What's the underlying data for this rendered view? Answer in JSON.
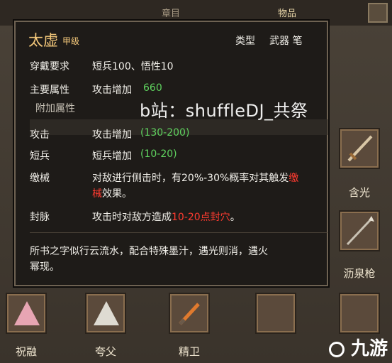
{
  "top_tabs": {
    "left": "章目",
    "right": "物品"
  },
  "tooltip": {
    "name": "太虚",
    "grade": "甲级",
    "type_label": "类型",
    "type_value": "武器 笔",
    "req_label": "穿戴要求",
    "req_value": "短兵100、悟性10",
    "main_label": "主要属性",
    "main_text": "攻击增加",
    "main_value": "660",
    "extra_header": "附加属性",
    "attack_label": "攻击",
    "attack_text": "攻击增加",
    "attack_value": "(130-200)",
    "short_label": "短兵",
    "short_text": "短兵增加",
    "short_value": "(10-20)",
    "disarm_label": "缴械",
    "disarm_text_1": "对敌进行侧击时，有20%-30%概率对其触发",
    "disarm_red_1": "缴",
    "disarm_red_2": "械",
    "disarm_text_2": "效果。",
    "seal_label": "封脉",
    "seal_text": "攻击时对敌方造成",
    "seal_red": "10-20点封穴",
    "seal_end": "。",
    "desc_1": "所书之字似行云流水，配合特殊墨汁，遇光则消，遇火",
    "desc_2": "幂现。"
  },
  "watermark": "b站：shuffleDJ_共祭",
  "logo": "九游",
  "items": {
    "hanguang": "含光",
    "liquanqiang": "沥泉枪",
    "zhurong": "祝融",
    "kuafu": "夸父",
    "jingwei": "精卫"
  },
  "colors": {
    "accent": "#f3c77a",
    "green": "#5fd35f",
    "red": "#ff3b30"
  }
}
